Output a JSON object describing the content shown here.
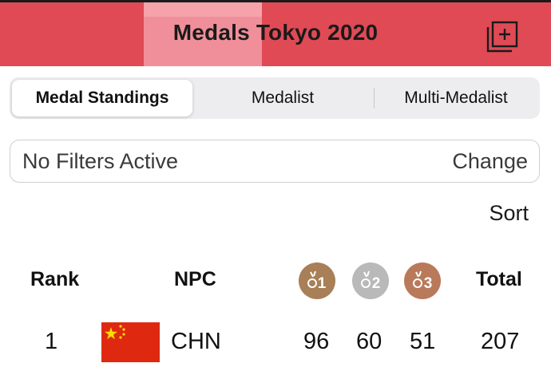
{
  "header": {
    "title": "Medals Tokyo 2020",
    "background": "#e04a55",
    "icon": "add-to-collection-icon"
  },
  "tabs": [
    {
      "label": "Medal Standings",
      "active": true
    },
    {
      "label": "Medalist",
      "active": false
    },
    {
      "label": "Multi-Medalist",
      "active": false
    }
  ],
  "filter": {
    "label": "No Filters Active",
    "action": "Change"
  },
  "sort_label": "Sort",
  "table": {
    "headers": {
      "rank": "Rank",
      "npc": "NPC",
      "gold": "1",
      "silver": "2",
      "bronze": "3",
      "total": "Total"
    },
    "medal_colors": {
      "gold": "#a87f56",
      "silver": "#b9b9b9",
      "bronze": "#b97a5b"
    },
    "rows": [
      {
        "rank": "1",
        "flag": "china-flag-icon",
        "npc": "CHN",
        "gold": "96",
        "silver": "60",
        "bronze": "51",
        "total": "207"
      }
    ]
  }
}
